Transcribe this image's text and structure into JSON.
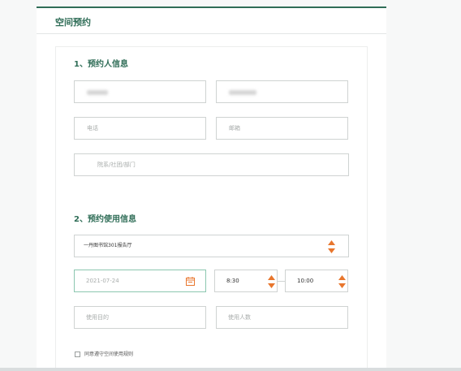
{
  "header": {
    "title": "空间预约"
  },
  "section1": {
    "title": "1、预约人信息",
    "phone_placeholder": "电话",
    "email_placeholder": "邮箱",
    "dept_placeholder": "院系/社团/部门"
  },
  "section2": {
    "title": "2、预约使用信息",
    "venue_value": "一丹图书馆301报告厅",
    "date_value": "2021-07-24",
    "start_time": "8:30",
    "end_time": "10:00",
    "purpose_placeholder": "使用目的",
    "people_placeholder": "使用人数"
  },
  "agreement": {
    "label": "同意遵守空间使用规则",
    "checked": false
  },
  "colors": {
    "accent": "#2f6d57",
    "spinner": "#e8762d",
    "date_border": "#8cc7b0"
  }
}
